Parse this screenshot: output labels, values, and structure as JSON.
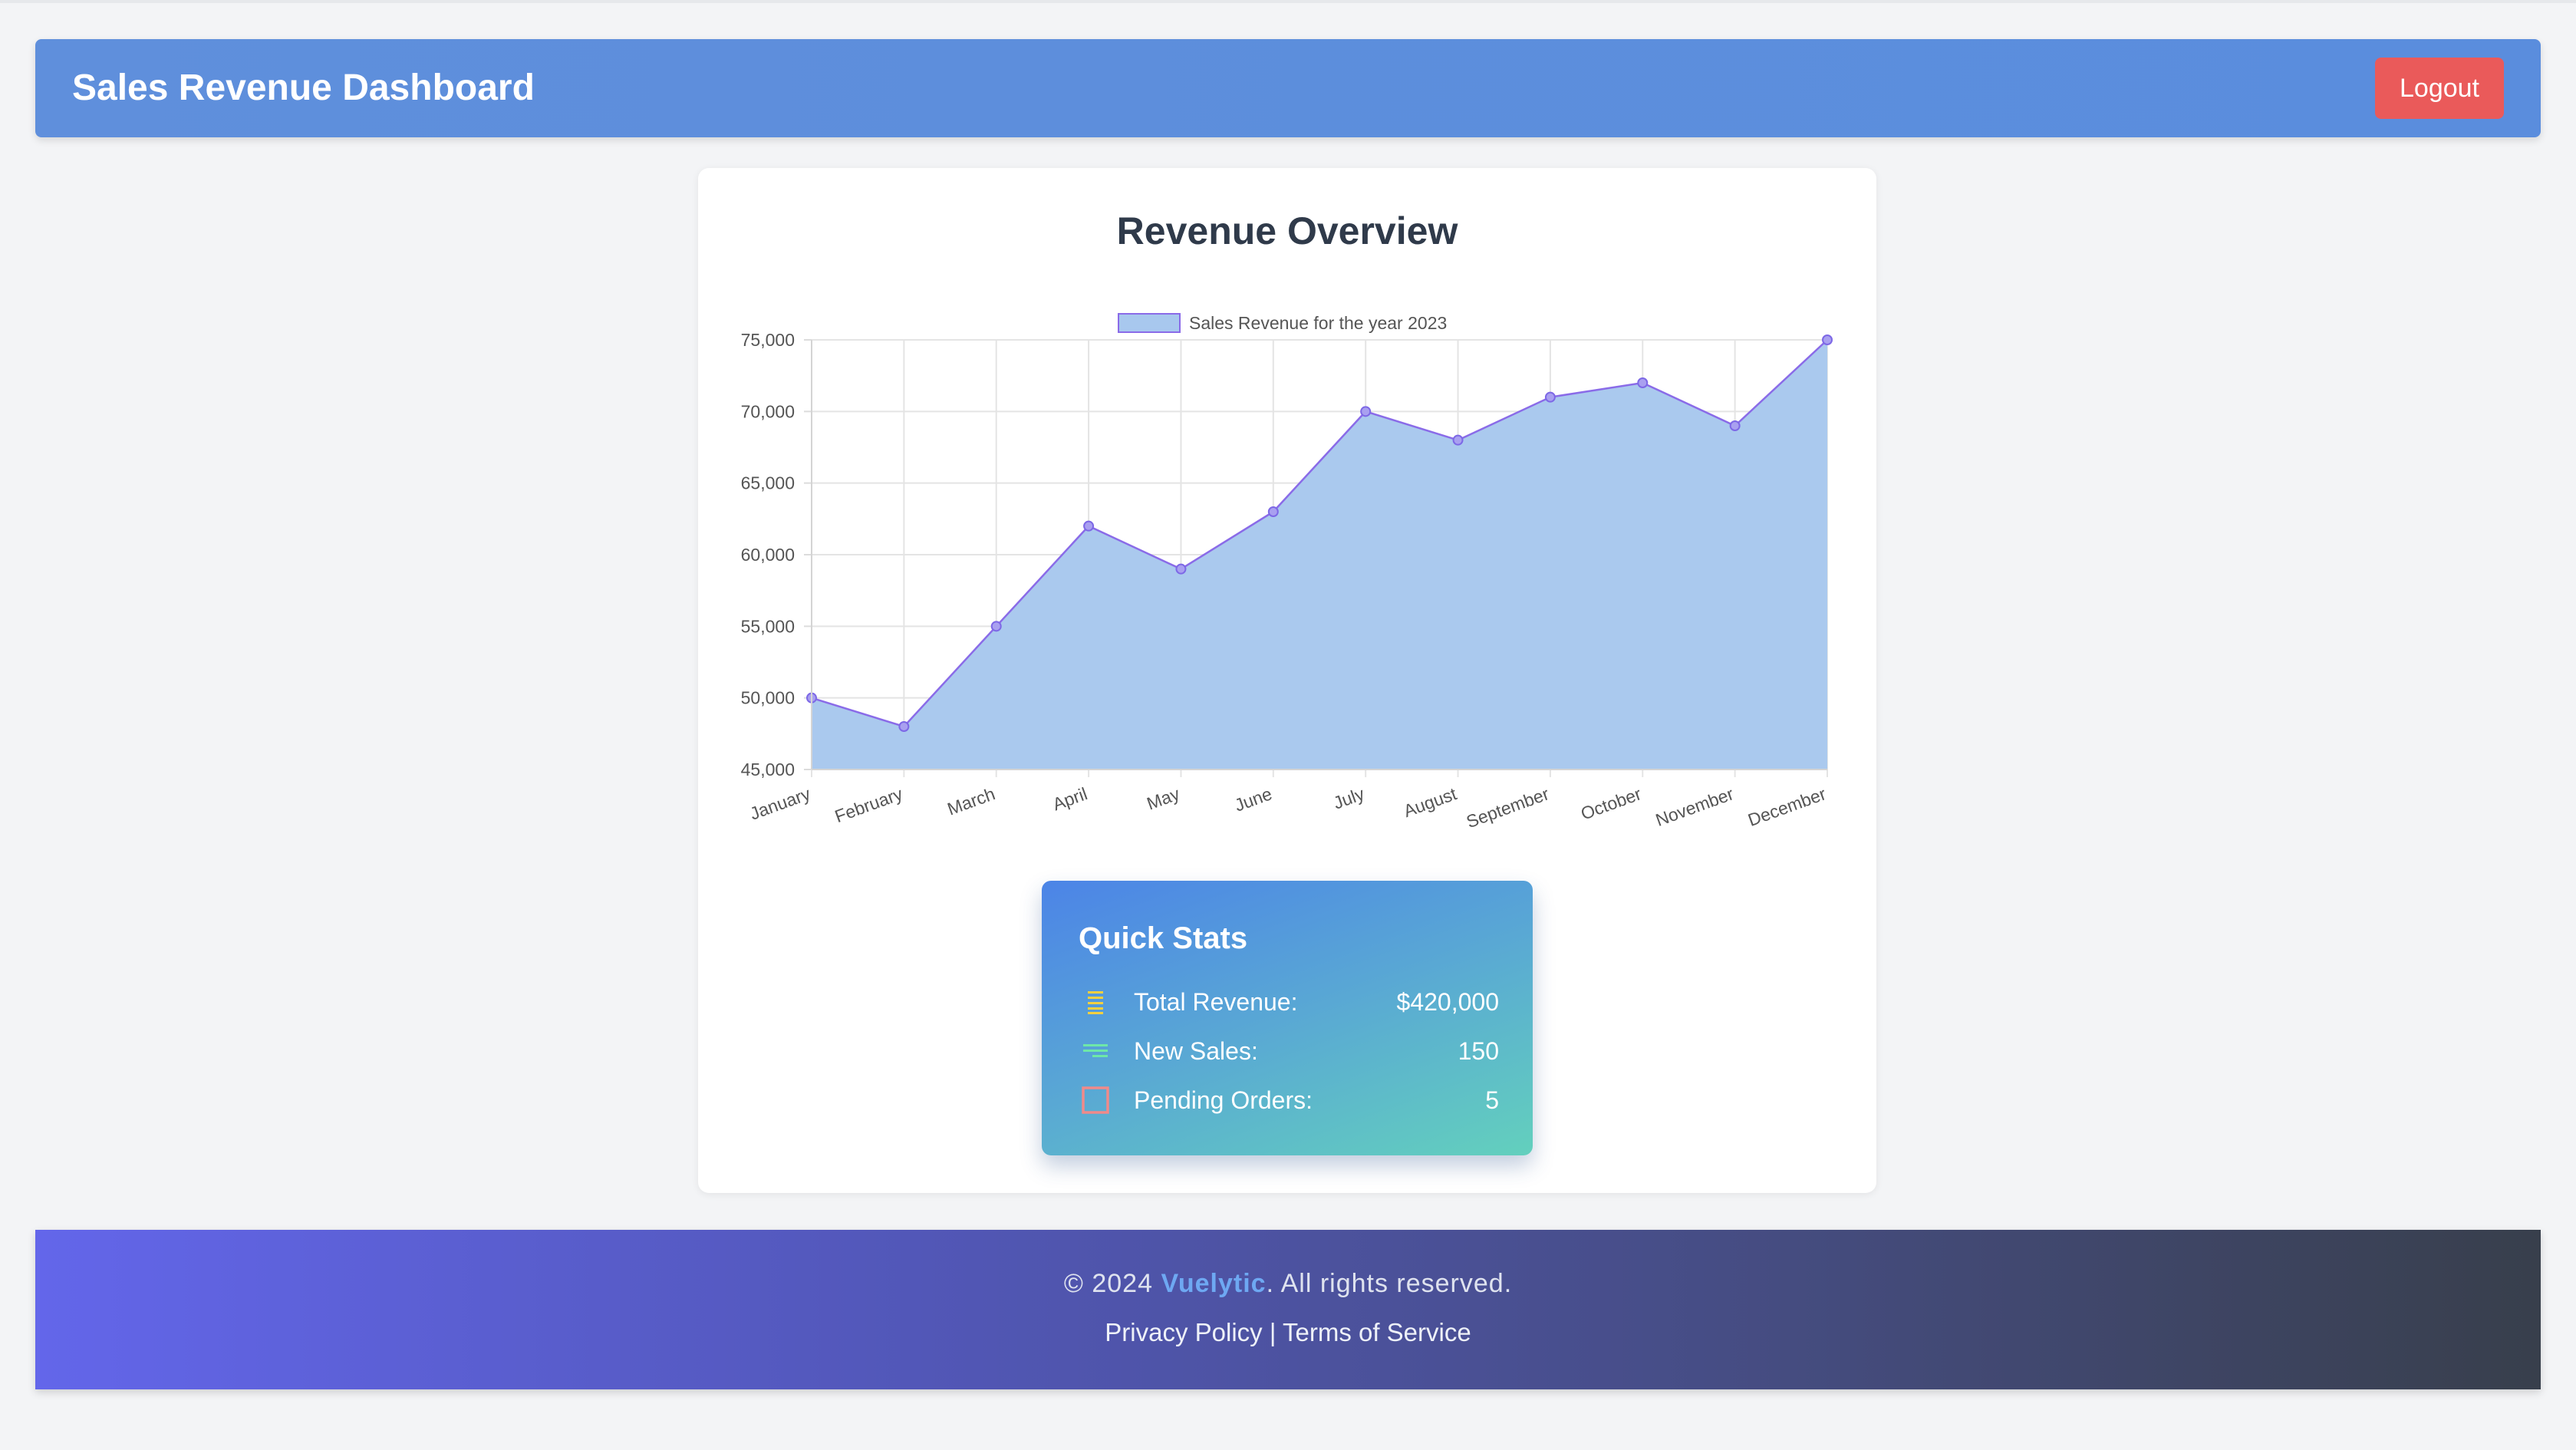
{
  "header": {
    "title": "Sales Revenue Dashboard",
    "logout_label": "Logout"
  },
  "main": {
    "title": "Revenue Overview"
  },
  "chart_data": {
    "type": "area",
    "title": "Revenue Overview",
    "categories": [
      "January",
      "February",
      "March",
      "April",
      "May",
      "June",
      "July",
      "August",
      "September",
      "October",
      "November",
      "December"
    ],
    "series": [
      {
        "name": "Sales Revenue for the year 2023",
        "values": [
          50000,
          48000,
          55000,
          62000,
          59000,
          63000,
          70000,
          68000,
          71000,
          72000,
          69000,
          75000
        ]
      }
    ],
    "ylim": [
      45000,
      75000
    ],
    "yticks": [
      45000,
      50000,
      55000,
      60000,
      65000,
      70000,
      75000
    ],
    "ytick_labels": [
      "45,000",
      "50,000",
      "55,000",
      "60,000",
      "65,000",
      "70,000",
      "75,000"
    ],
    "xlabel": "",
    "ylabel": "",
    "grid": true,
    "legend": "top-center",
    "fill_color": "#a8c8ee",
    "line_color": "#8a6be8"
  },
  "quick_stats": {
    "title": "Quick Stats",
    "items": [
      {
        "icon": "list-icon",
        "label": "Total Revenue:",
        "value": "$420,000",
        "icon_color": "#f4d03f"
      },
      {
        "icon": "lines-icon",
        "label": "New Sales:",
        "value": "150",
        "icon_color": "#6ee7a8"
      },
      {
        "icon": "square-icon",
        "label": "Pending Orders:",
        "value": "5",
        "icon_color": "#f08a8a"
      }
    ]
  },
  "footer": {
    "copyright_prefix": "© 2024 ",
    "brand": "Vuelytic",
    "copyright_suffix": ". All rights reserved.",
    "privacy_label": "Privacy Policy",
    "separator": " | ",
    "terms_label": "Terms of Service"
  }
}
